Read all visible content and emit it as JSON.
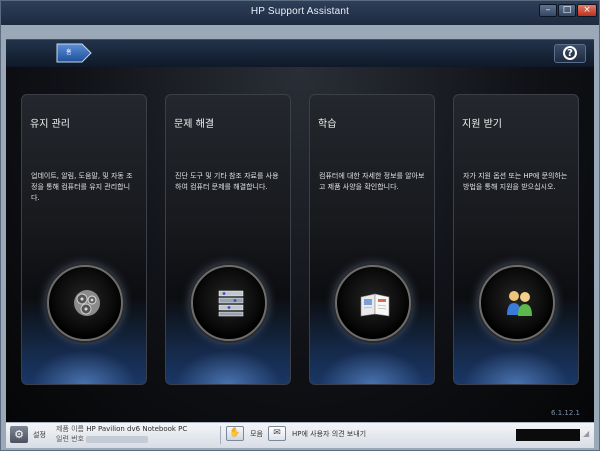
{
  "window": {
    "title": "HP Support Assistant",
    "controls": {
      "minimize": "–",
      "maximize": "□",
      "close": "×"
    }
  },
  "nav": {
    "home_label": "홈",
    "help_symbol": "?"
  },
  "cards": [
    {
      "title": "유지 관리",
      "description": "업데이트, 알림, 도움말, 및 자동 조정을 통해 컴퓨터를 유지 관리합니다.",
      "icon": "gears-icon"
    },
    {
      "title": "문제 해결",
      "description": "진단 도구 및 기타 참조 자료를 사용하여 컴퓨터 문제를 해결합니다.",
      "icon": "tools-icon"
    },
    {
      "title": "학습",
      "description": "컴퓨터에 대한 자세한 정보를 알아보고 제품 사양을 확인합니다.",
      "icon": "book-icon"
    },
    {
      "title": "지원 받기",
      "description": "자가 지원 옵션 또는 HP에 문의하는 방법을 통해 지원을 받으십시오.",
      "icon": "people-icon"
    }
  ],
  "version": "6.1.12.1",
  "status": {
    "settings_label": "설정",
    "product_name_key": "제품 이름",
    "product_name_value": "HP Pavilion dv6 Notebook PC",
    "serial_key": "일련 번호",
    "favorites_label": "모음",
    "feedback_label": "HP에 사용자 의견 보내기"
  },
  "colors": {
    "titlebar": "#1d2a40",
    "stage_bg": "#101217",
    "card_glow": "#5884c4",
    "statusbar": "#d8dde5"
  }
}
